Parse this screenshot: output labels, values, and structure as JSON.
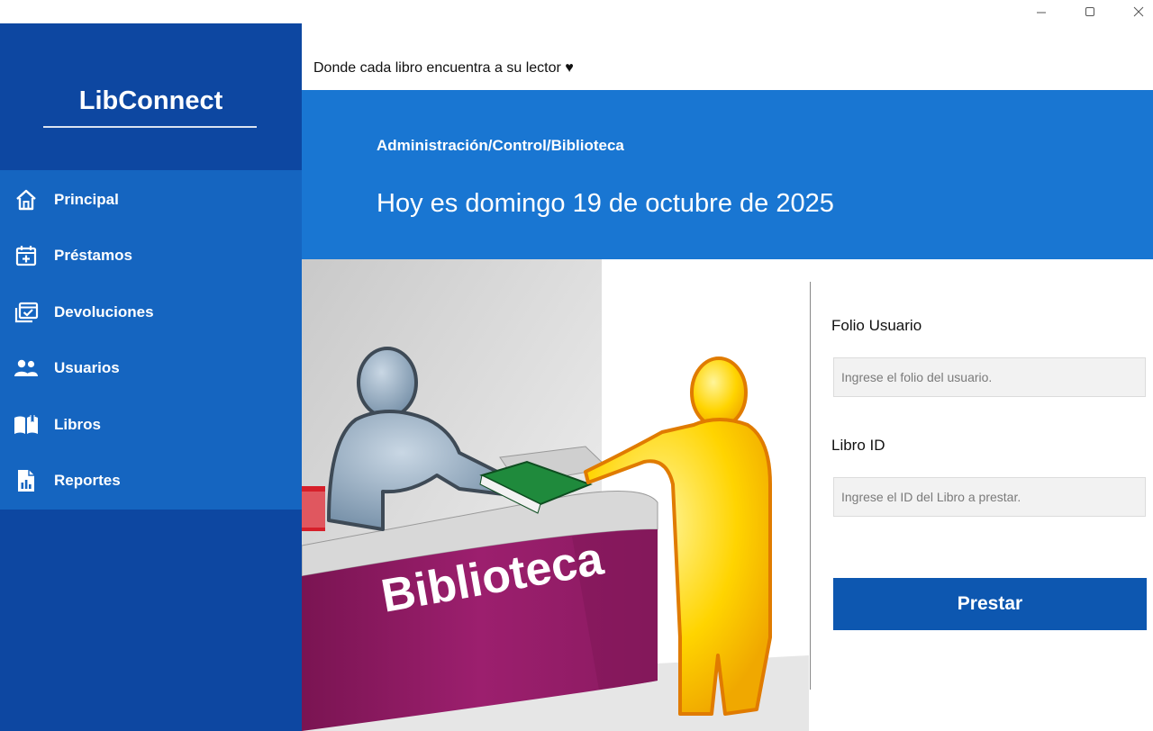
{
  "window": {
    "controls": [
      "minimize-icon",
      "maximize-icon",
      "close-icon"
    ]
  },
  "app": {
    "name": "LibConnect",
    "slogan": "Donde cada libro encuentra a su lector ♥"
  },
  "sidebar": {
    "items": [
      {
        "label": "Principal",
        "icon": "home-icon"
      },
      {
        "label": "Préstamos",
        "icon": "calendar-plus-icon"
      },
      {
        "label": "Devoluciones",
        "icon": "calendar-check-icon"
      },
      {
        "label": "Usuarios",
        "icon": "users-icon"
      },
      {
        "label": "Libros",
        "icon": "book-open-icon"
      },
      {
        "label": "Reportes",
        "icon": "report-icon"
      }
    ]
  },
  "header": {
    "breadcrumb": "Administración/Control/Biblioteca",
    "date": "Hoy es domingo 19 de octubre de 2025"
  },
  "illustration": {
    "counter_text": "Biblioteca"
  },
  "form": {
    "folio_label": "Folio Usuario",
    "folio_placeholder": "Ingrese el folio del usuario.",
    "folio_value": "",
    "libro_label": "Libro ID",
    "libro_placeholder": "Ingrese el ID del Libro a prestar.",
    "libro_value": "",
    "submit_label": "Prestar"
  },
  "colors": {
    "sidebar_dark": "#0d47a1",
    "sidebar_nav": "#1565c0",
    "banner": "#1976d2",
    "button": "#0d57b0",
    "counter_magenta": "#9c1f6e",
    "figure_yellow": "#ffd400",
    "figure_gray": "#8fa6bd"
  }
}
